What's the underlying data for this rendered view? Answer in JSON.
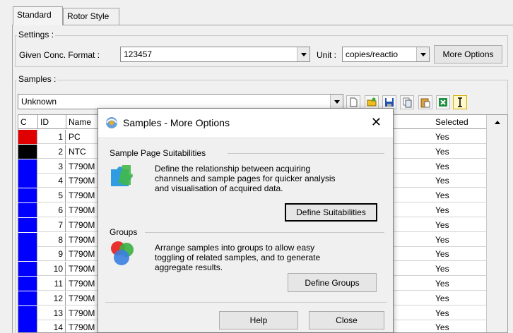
{
  "tabs": [
    "Standard",
    "Rotor Style"
  ],
  "settings": {
    "group_label": "Settings :",
    "conc_label": "Given Conc. Format :",
    "conc_value": "123457",
    "unit_label": "Unit :",
    "unit_value": "copies/reactio",
    "more_options": "More Options"
  },
  "samples": {
    "group_label": "Samples :",
    "type_value": "Unknown"
  },
  "grid": {
    "headers": {
      "color": "C",
      "id": "ID",
      "name": "Name",
      "selected": "Selected"
    },
    "rows": [
      {
        "color": "#e00000",
        "id": "1",
        "name": "PC",
        "selected": "Yes"
      },
      {
        "color": "#000000",
        "id": "2",
        "name": "NTC",
        "selected": "Yes"
      },
      {
        "color": "#0000ff",
        "id": "3",
        "name": "T790M",
        "selected": "Yes"
      },
      {
        "color": "#0000ff",
        "id": "4",
        "name": "T790M",
        "selected": "Yes"
      },
      {
        "color": "#0000ff",
        "id": "5",
        "name": "T790M",
        "selected": "Yes"
      },
      {
        "color": "#0000ff",
        "id": "6",
        "name": "T790M",
        "selected": "Yes"
      },
      {
        "color": "#0000ff",
        "id": "7",
        "name": "T790M",
        "selected": "Yes"
      },
      {
        "color": "#0000ff",
        "id": "8",
        "name": "T790M",
        "selected": "Yes"
      },
      {
        "color": "#0000ff",
        "id": "9",
        "name": "T790M",
        "selected": "Yes"
      },
      {
        "color": "#0000ff",
        "id": "10",
        "name": "T790M",
        "selected": "Yes"
      },
      {
        "color": "#0000ff",
        "id": "11",
        "name": "T790M",
        "selected": "Yes"
      },
      {
        "color": "#0000ff",
        "id": "12",
        "name": "T790M",
        "selected": "Yes"
      },
      {
        "color": "#0000ff",
        "id": "13",
        "name": "T790M",
        "selected": "Yes"
      },
      {
        "color": "#0000ff",
        "id": "14",
        "name": "T790M",
        "selected": "Yes"
      }
    ]
  },
  "dialog": {
    "title": "Samples - More Options",
    "close_glyph": "✕",
    "suit_title": "Sample Page Suitabilities",
    "suit_line1": "Define the relationship between acquiring",
    "suit_line2": "channels and sample pages for quicker analysis",
    "suit_line3": "and visualisation of acquired data.",
    "suit_button": "Define Suitabilities",
    "groups_title": "Groups",
    "groups_line1": "Arrange samples into groups to allow easy",
    "groups_line2": "toggling of related samples, and to generate",
    "groups_line3": "aggregate results.",
    "groups_button": "Define Groups",
    "help_button": "Help",
    "close_button": "Close"
  }
}
